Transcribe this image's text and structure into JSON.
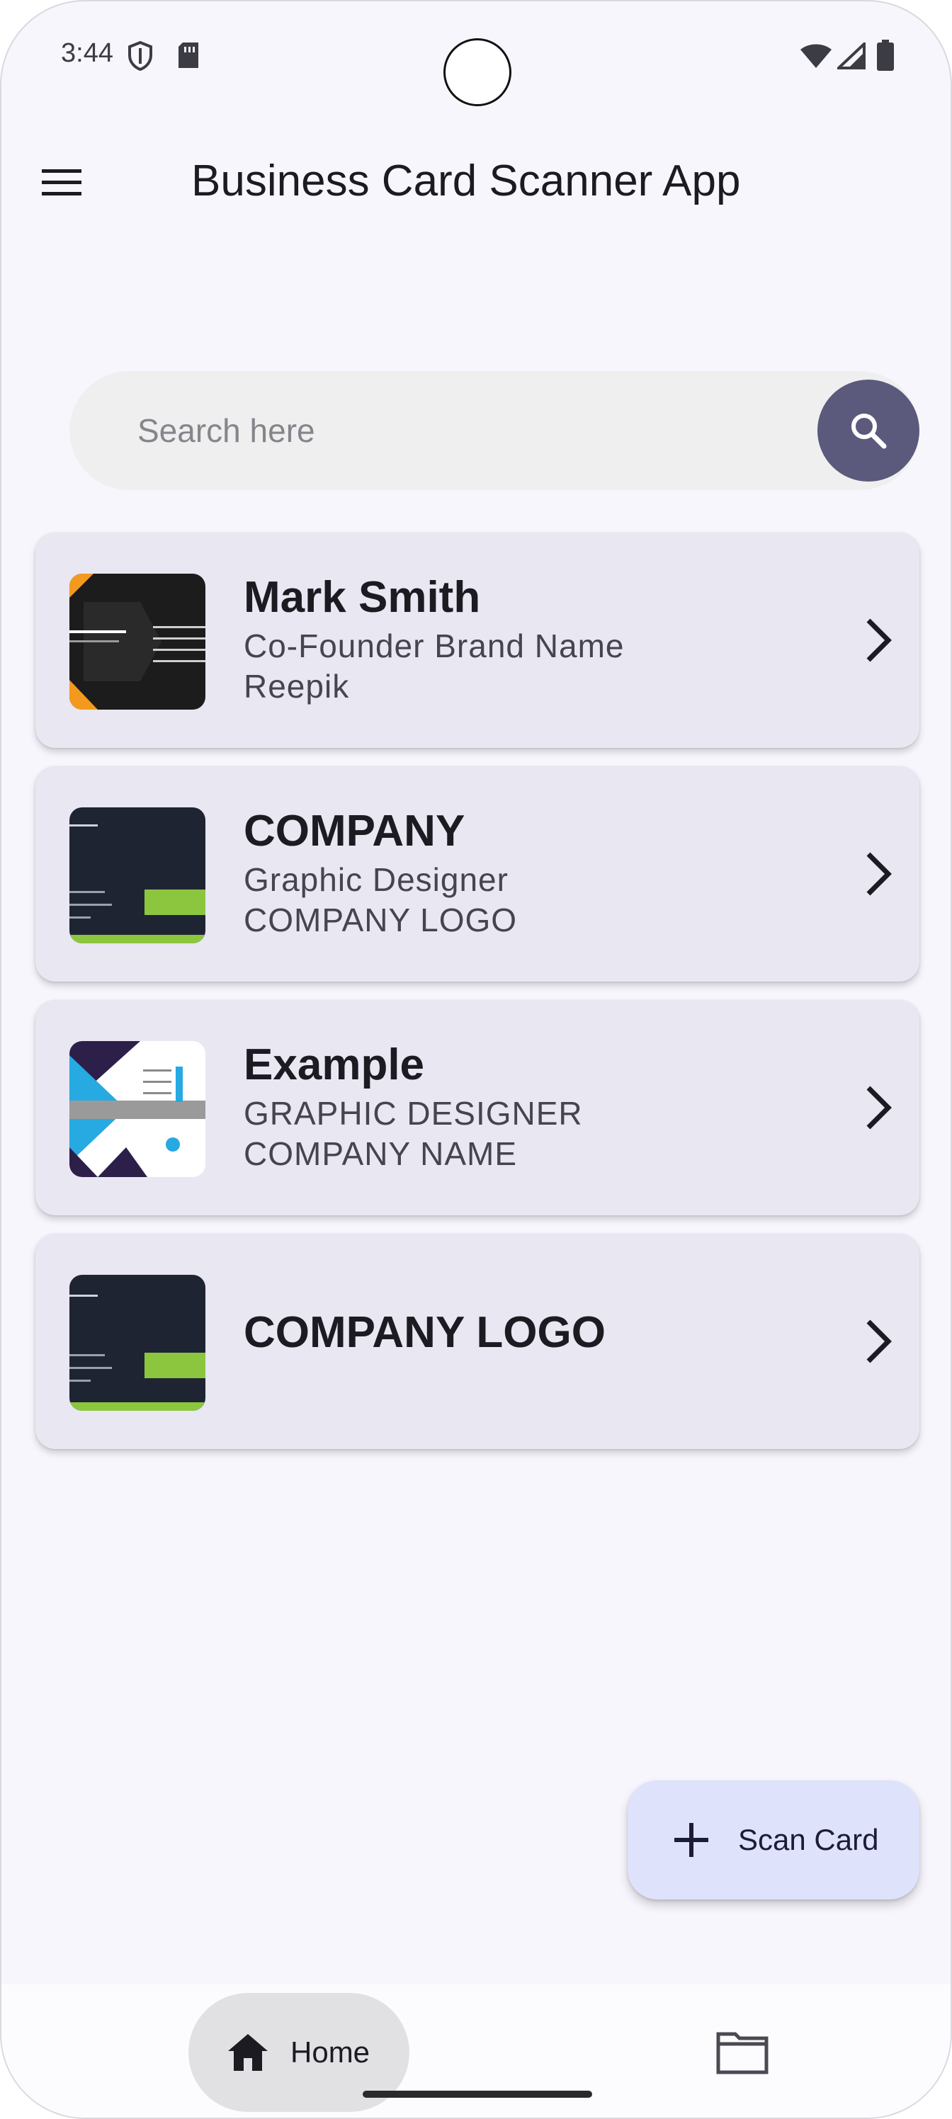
{
  "status_bar": {
    "time": "3:44"
  },
  "app_bar": {
    "title": "Business Card Scanner App"
  },
  "search": {
    "placeholder": "Search here",
    "value": ""
  },
  "cards": [
    {
      "name": "Mark Smith",
      "line1": "Co-Founder Brand Name",
      "line2": "Reepik",
      "thumb_style": "dark-orange"
    },
    {
      "name": "COMPANY",
      "line1": "Graphic Designer",
      "line2": "COMPANY LOGO",
      "thumb_style": "navy-green"
    },
    {
      "name": "Example",
      "line1": "GRAPHIC DESIGNER",
      "line2": "COMPANY NAME",
      "thumb_style": "blue-white"
    },
    {
      "name": "COMPANY LOGO",
      "line1": "",
      "line2": "",
      "thumb_style": "navy-green"
    }
  ],
  "fab": {
    "label": "Scan Card",
    "icon": "plus-icon"
  },
  "bottom_nav": {
    "home_label": "Home",
    "items": [
      {
        "icon": "home-icon",
        "selected": true
      },
      {
        "icon": "folder-icon",
        "selected": false
      }
    ]
  },
  "colors": {
    "background": "#f7f6fd",
    "card": "#e8e7f2",
    "search_button": "#5b5a7d",
    "fab": "#dfe2fb",
    "nav_selected": "#e1e1e4"
  }
}
